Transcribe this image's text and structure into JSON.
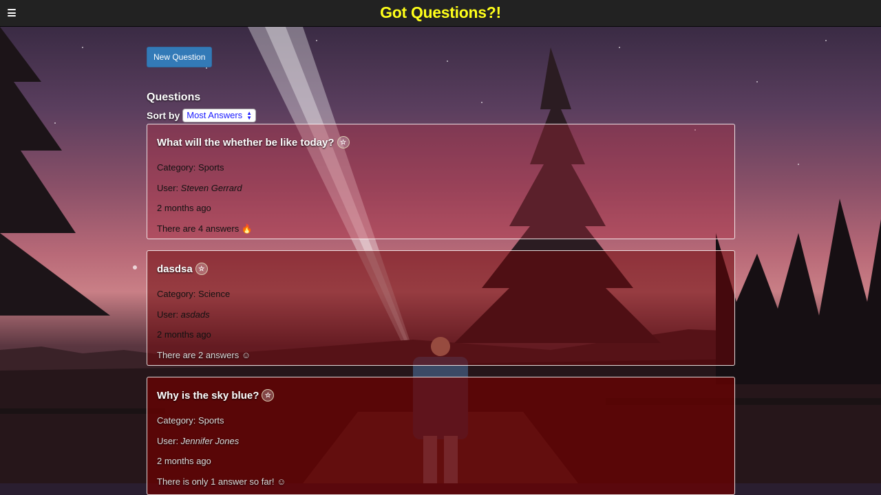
{
  "app": {
    "title": "Got Questions?!"
  },
  "toolbar": {
    "new_question_label": "New Question"
  },
  "questions_section": {
    "heading": "Questions",
    "sort_label": "Sort by",
    "sort_selected": "Most Answers"
  },
  "questions": [
    {
      "title": "What will the whether be like today?",
      "category": "Category: Sports",
      "user_label": "User: ",
      "user_name": "Steven Gerrard",
      "time": "2 months ago",
      "answers": "There are 4 answers 🔥"
    },
    {
      "title": "dasdsa",
      "category": "Category: Science",
      "user_label": "User: ",
      "user_name": "asdads",
      "time": "2 months ago",
      "answers": "There are 2 answers ☺"
    },
    {
      "title": "Why is the sky blue?",
      "category": "Category: Sports",
      "user_label": "User: ",
      "user_name": "Jennifer Jones",
      "time": "2 months ago",
      "answers": "There is only 1 answer so far! ☺"
    }
  ],
  "icons": {
    "menu": "hamburger-menu-icon",
    "favorite": "star-icon"
  },
  "colors": {
    "brand": "#ffff1a",
    "primary_button": "#337ab7",
    "navbar": "#222222"
  }
}
